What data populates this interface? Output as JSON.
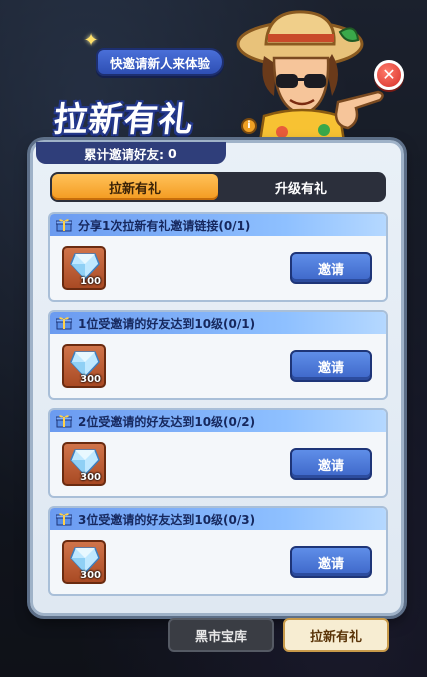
{
  "banner": {
    "invite_text": "快邀请新人来体验"
  },
  "title": {
    "main": "拉新有礼",
    "count_label": "累计邀请好友:",
    "count_value": "0"
  },
  "tabs": [
    {
      "label": "拉新有礼",
      "active": true
    },
    {
      "label": "升级有礼",
      "active": false
    }
  ],
  "tasks": [
    {
      "title": "分享1次拉新有礼邀请链接(0/1)",
      "reward_qty": "100",
      "button": "邀请"
    },
    {
      "title": "1位受邀请的好友达到10级(0/1)",
      "reward_qty": "300",
      "button": "邀请"
    },
    {
      "title": "2位受邀请的好友达到10级(0/2)",
      "reward_qty": "300",
      "button": "邀请"
    },
    {
      "title": "3位受邀请的好友达到10级(0/3)",
      "reward_qty": "300",
      "button": "邀请"
    }
  ],
  "bottom_tabs": [
    {
      "label": "黑市宝库",
      "active": false
    },
    {
      "label": "拉新有礼",
      "active": true
    }
  ],
  "icons": {
    "close": "close-icon",
    "info": "info-icon",
    "gift": "gift-icon",
    "gem": "diamond-gem-icon",
    "sparkle": "sparkle-icon"
  },
  "colors": {
    "accent_orange": "#f39a1f",
    "button_blue": "#3d66c8",
    "panel_bg": "#e9f0f7"
  }
}
